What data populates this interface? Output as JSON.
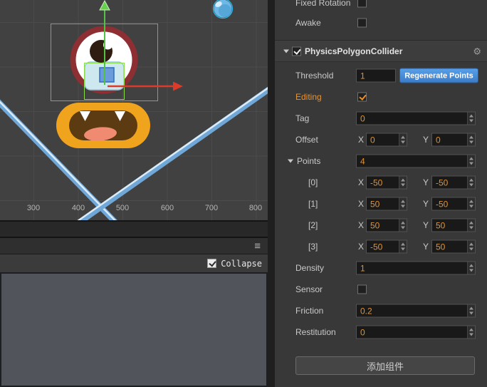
{
  "icons": {
    "gear": "⚙",
    "menu": "≡"
  },
  "viewport": {
    "ruler": [
      "300",
      "400",
      "500",
      "600",
      "700",
      "800"
    ]
  },
  "bottom_panel": {
    "collapse_label": "Collapse"
  },
  "inspector": {
    "fixed_rotation": {
      "label": "Fixed Rotation"
    },
    "awake": {
      "label": "Awake"
    },
    "collider": {
      "title": "PhysicsPolygonCollider"
    },
    "threshold": {
      "label": "Threshold",
      "value": "1",
      "button_label": "Regenerate Points"
    },
    "editing": {
      "label": "Editing"
    },
    "tag": {
      "label": "Tag",
      "value": "0"
    },
    "axis": {
      "x": "X",
      "y": "Y"
    },
    "offset": {
      "label": "Offset",
      "x": "0",
      "y": "0"
    },
    "points": {
      "label": "Points",
      "count": "4",
      "items": [
        {
          "index": "[0]",
          "x": "-50",
          "y": "-50"
        },
        {
          "index": "[1]",
          "x": "50",
          "y": "-50"
        },
        {
          "index": "[2]",
          "x": "50",
          "y": "50"
        },
        {
          "index": "[3]",
          "x": "-50",
          "y": "50"
        }
      ]
    },
    "density": {
      "label": "Density",
      "value": "1"
    },
    "sensor": {
      "label": "Sensor"
    },
    "friction": {
      "label": "Friction",
      "value": "0.2"
    },
    "restitution": {
      "label": "Restitution",
      "value": "0"
    },
    "add_component_label": "添加组件"
  },
  "colors": {
    "accent_orange": "#e1922f",
    "button_blue": "#3c7cc6",
    "selection_cyan": "#2fb5e8",
    "gizmo_green": "#53c243",
    "gizmo_red": "#dd3a2a"
  }
}
